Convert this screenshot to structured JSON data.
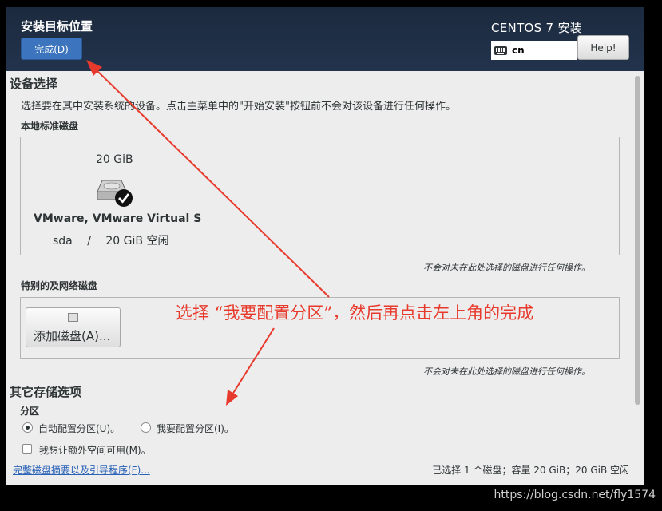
{
  "header": {
    "title": "安装目标位置",
    "done_label": "完成(D)",
    "product": "CENTOS 7 安装",
    "keyboard_layout": "cn",
    "help_label": "Help!"
  },
  "device_selection": {
    "heading": "设备选择",
    "description": "选择要在其中安装系统的设备。点击主菜单中的\"开始安装\"按钮前不会对该设备进行任何操作。",
    "local_disks_label": "本地标准磁盘",
    "disk": {
      "size": "20 GiB",
      "name": "VMware, VMware Virtual S",
      "device": "sda",
      "separator": "/",
      "free": "20 GiB 空闲"
    },
    "local_note": "不会对未在此处选择的磁盘进行任何操作。",
    "special_disks_label": "特别的及网络磁盘",
    "add_disk_label": "添加磁盘(A)...",
    "special_note": "不会对未在此处选择的磁盘进行任何操作。"
  },
  "other_storage": {
    "heading": "其它存储选项",
    "partitioning_label": "分区",
    "auto_partition_label": "自动配置分区(U)。",
    "manual_partition_label": "我要配置分区(I)。",
    "extra_space_label": "我想让额外空间可用(M)。"
  },
  "footer": {
    "summary_link": "完整磁盘摘要以及引导程序(F)...",
    "selection_summary": "已选择 1 个磁盘；容量 20 GiB；20 GiB 空闲"
  },
  "annotation": {
    "text": "选择 “我要配置分区”，然后再点击左上角的完成"
  },
  "watermark": "https://blog.csdn.net/fly1574",
  "colors": {
    "header_bg": "#1f2f45",
    "done_button": "#3c75bd",
    "annotation_red": "#e83a2c",
    "link_blue": "#2a62b8"
  }
}
